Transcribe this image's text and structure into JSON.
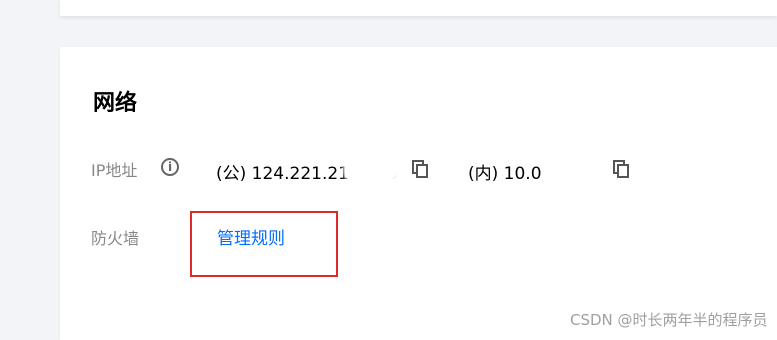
{
  "network": {
    "title": "网络",
    "ip_label": "IP地址",
    "public_ip": "(公) 124.221.21       3",
    "private_ip": "(内) 10.0           ",
    "firewall_label": "防火墙",
    "firewall_link": "管理规则"
  },
  "icons": {
    "info": "i",
    "copy_public": "copy-icon",
    "copy_private": "copy-icon"
  },
  "colors": {
    "link": "#006eff",
    "highlight": "#e02a2a",
    "background": "#f3f4f7",
    "card": "#ffffff"
  },
  "watermark": "CSDN @时长两年半的程序员"
}
